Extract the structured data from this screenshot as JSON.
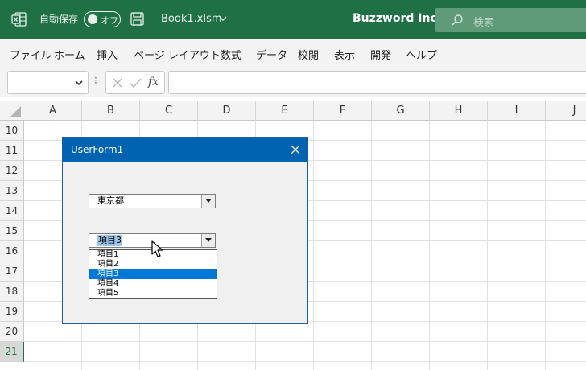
{
  "titlebar": {
    "autosave_label": "自動保存",
    "autosave_state": "オフ",
    "filename": "Book1.xlsm",
    "company": "Buzzword Inc.",
    "search_placeholder": "検索",
    "accent": "#1f7145"
  },
  "menu": [
    "ファイル",
    "ホーム",
    "挿入",
    "ページ レイアウト",
    "数式",
    "データ",
    "校閲",
    "表示",
    "開発",
    "ヘルプ"
  ],
  "formula_bar": {
    "name_box": "",
    "formula": "",
    "fx_label": "fx"
  },
  "sheet": {
    "columns": [
      "A",
      "B",
      "C",
      "D",
      "E",
      "F",
      "G",
      "H",
      "I",
      "J"
    ],
    "rows": [
      "10",
      "11",
      "12",
      "13",
      "14",
      "15",
      "16",
      "17",
      "18",
      "19",
      "20",
      "21"
    ],
    "selected_row": "21"
  },
  "userform": {
    "title": "UserForm1",
    "combo1_value": "東京都",
    "combo2_value": "項目3",
    "items": [
      "項目1",
      "項目2",
      "項目3",
      "項目4",
      "項目5"
    ],
    "selected_index": 2
  }
}
